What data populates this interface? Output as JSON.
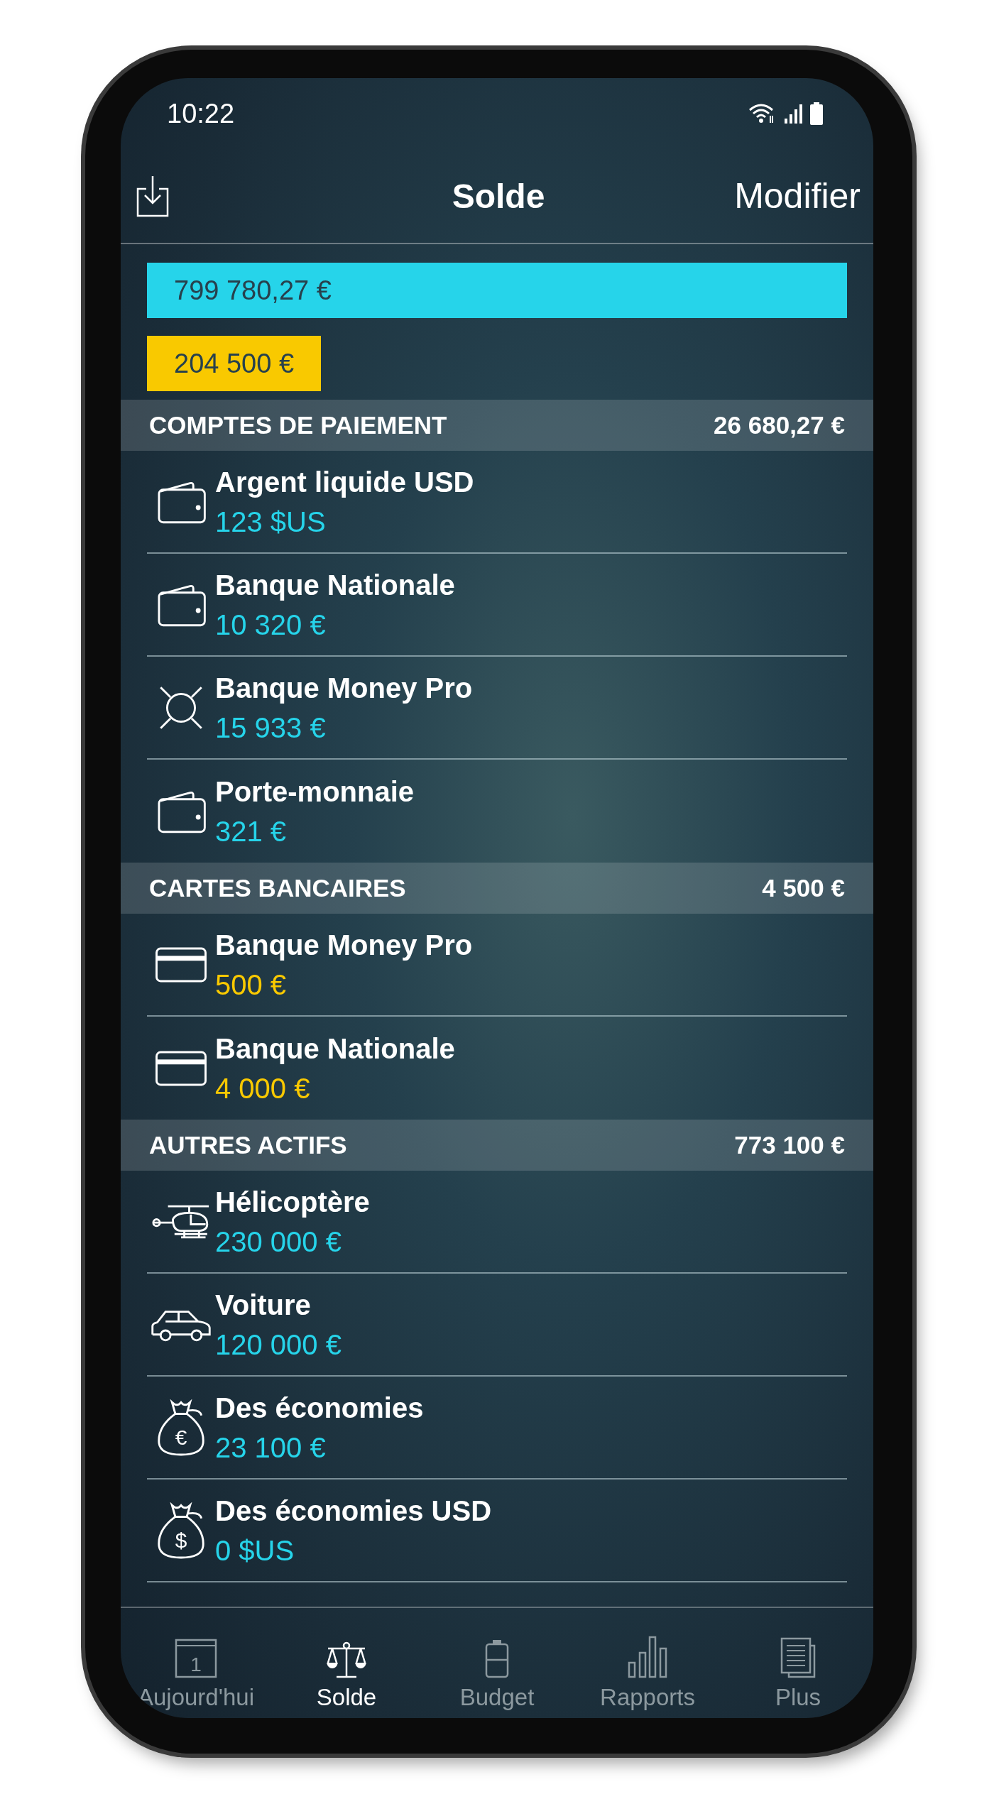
{
  "status_bar": {
    "time": "10:22"
  },
  "header": {
    "title": "Solde",
    "action": "Modifier"
  },
  "summary_bars": [
    {
      "kind": "assets",
      "amount": "799 780,27 €",
      "color": "#26d4ea"
    },
    {
      "kind": "debts",
      "amount": "204 500 €",
      "color": "#f9c900"
    }
  ],
  "sections": [
    {
      "title": "COMPTES DE PAIEMENT",
      "total": "26 680,27 €",
      "color": "#26d4ea",
      "accounts": [
        {
          "kind": "wallet",
          "name": "Argent liquide USD",
          "amount": "123 $US"
        },
        {
          "kind": "wallet",
          "name": "Banque Nationale",
          "amount": "10 320 €"
        },
        {
          "kind": "currency",
          "name": "Banque Money Pro",
          "amount": "15 933 €"
        },
        {
          "kind": "wallet",
          "name": "Porte-monnaie",
          "amount": "321 €"
        }
      ]
    },
    {
      "title": "CARTES BANCAIRES",
      "total": "4 500 €",
      "color": "#f9c900",
      "accounts": [
        {
          "kind": "card",
          "name": "Banque Money Pro",
          "amount": "500 €"
        },
        {
          "kind": "card",
          "name": "Banque Nationale",
          "amount": "4 000 €"
        }
      ]
    },
    {
      "title": "AUTRES ACTIFS",
      "total": "773 100 €",
      "color": "#26d4ea",
      "accounts": [
        {
          "kind": "helicopter",
          "name": "Hélicoptère",
          "amount": "230 000 €"
        },
        {
          "kind": "car",
          "name": "Voiture",
          "amount": "120 000 €"
        },
        {
          "kind": "moneybag",
          "symbol": "€",
          "name": "Des économies",
          "amount": "23 100 €"
        },
        {
          "kind": "moneybag",
          "symbol": "$",
          "name": "Des économies USD",
          "amount": "0 $US"
        }
      ]
    }
  ],
  "tab_bar": [
    {
      "kind": "calendar",
      "label": "Aujourd'hui",
      "calendar_day": "1",
      "selected": false
    },
    {
      "kind": "scales",
      "label": "Solde",
      "selected": true
    },
    {
      "kind": "budget",
      "label": "Budget",
      "selected": false
    },
    {
      "kind": "reports",
      "label": "Rapports",
      "selected": false
    },
    {
      "kind": "more",
      "label": "Plus",
      "selected": false
    }
  ]
}
